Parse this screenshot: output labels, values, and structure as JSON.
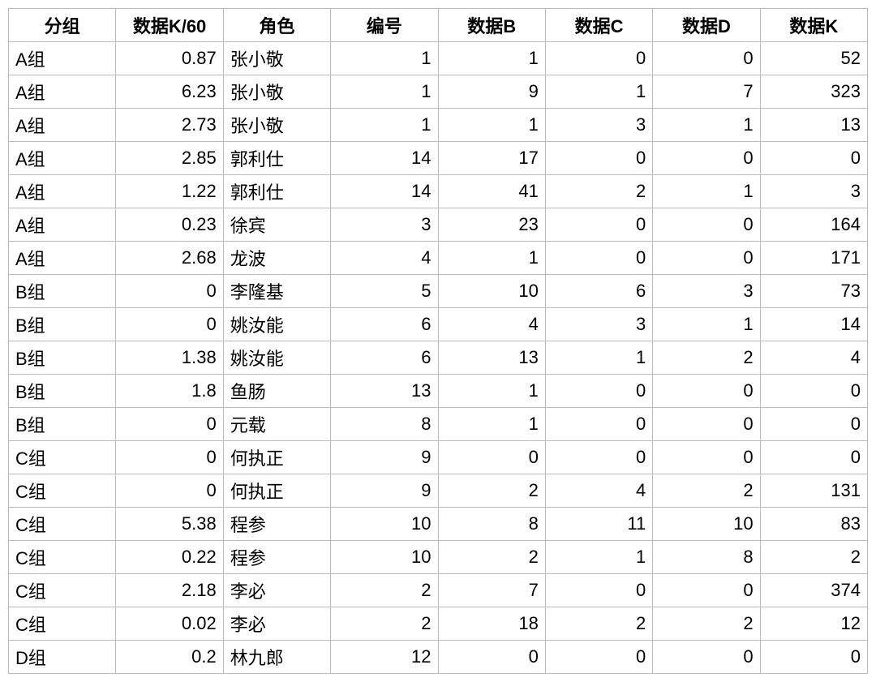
{
  "table": {
    "headers": [
      "分组",
      "数据K/60",
      "角色",
      "编号",
      "数据B",
      "数据C",
      "数据D",
      "数据K"
    ],
    "rows": [
      {
        "group": "A组",
        "k60": "0.87",
        "role": "张小敬",
        "no": "1",
        "b": "1",
        "c": "0",
        "d": "0",
        "k": "52"
      },
      {
        "group": "A组",
        "k60": "6.23",
        "role": "张小敬",
        "no": "1",
        "b": "9",
        "c": "1",
        "d": "7",
        "k": "323"
      },
      {
        "group": "A组",
        "k60": "2.73",
        "role": "张小敬",
        "no": "1",
        "b": "1",
        "c": "3",
        "d": "1",
        "k": "13"
      },
      {
        "group": "A组",
        "k60": "2.85",
        "role": "郭利仕",
        "no": "14",
        "b": "17",
        "c": "0",
        "d": "0",
        "k": "0"
      },
      {
        "group": "A组",
        "k60": "1.22",
        "role": "郭利仕",
        "no": "14",
        "b": "41",
        "c": "2",
        "d": "1",
        "k": "3"
      },
      {
        "group": "A组",
        "k60": "0.23",
        "role": "徐宾",
        "no": "3",
        "b": "23",
        "c": "0",
        "d": "0",
        "k": "164"
      },
      {
        "group": "A组",
        "k60": "2.68",
        "role": "龙波",
        "no": "4",
        "b": "1",
        "c": "0",
        "d": "0",
        "k": "171"
      },
      {
        "group": "B组",
        "k60": "0",
        "role": "李隆基",
        "no": "5",
        "b": "10",
        "c": "6",
        "d": "3",
        "k": "73"
      },
      {
        "group": "B组",
        "k60": "0",
        "role": "姚汝能",
        "no": "6",
        "b": "4",
        "c": "3",
        "d": "1",
        "k": "14"
      },
      {
        "group": "B组",
        "k60": "1.38",
        "role": "姚汝能",
        "no": "6",
        "b": "13",
        "c": "1",
        "d": "2",
        "k": "4"
      },
      {
        "group": "B组",
        "k60": "1.8",
        "role": "鱼肠",
        "no": "13",
        "b": "1",
        "c": "0",
        "d": "0",
        "k": "0"
      },
      {
        "group": "B组",
        "k60": "0",
        "role": "元载",
        "no": "8",
        "b": "1",
        "c": "0",
        "d": "0",
        "k": "0"
      },
      {
        "group": "C组",
        "k60": "0",
        "role": "何执正",
        "no": "9",
        "b": "0",
        "c": "0",
        "d": "0",
        "k": "0"
      },
      {
        "group": "C组",
        "k60": "0",
        "role": "何执正",
        "no": "9",
        "b": "2",
        "c": "4",
        "d": "2",
        "k": "131"
      },
      {
        "group": "C组",
        "k60": "5.38",
        "role": "程参",
        "no": "10",
        "b": "8",
        "c": "11",
        "d": "10",
        "k": "83"
      },
      {
        "group": "C组",
        "k60": "0.22",
        "role": "程参",
        "no": "10",
        "b": "2",
        "c": "1",
        "d": "8",
        "k": "2"
      },
      {
        "group": "C组",
        "k60": "2.18",
        "role": "李必",
        "no": "2",
        "b": "7",
        "c": "0",
        "d": "0",
        "k": "374"
      },
      {
        "group": "C组",
        "k60": "0.02",
        "role": "李必",
        "no": "2",
        "b": "18",
        "c": "2",
        "d": "2",
        "k": "12"
      },
      {
        "group": "D组",
        "k60": "0.2",
        "role": "林九郎",
        "no": "12",
        "b": "0",
        "c": "0",
        "d": "0",
        "k": "0"
      }
    ]
  }
}
